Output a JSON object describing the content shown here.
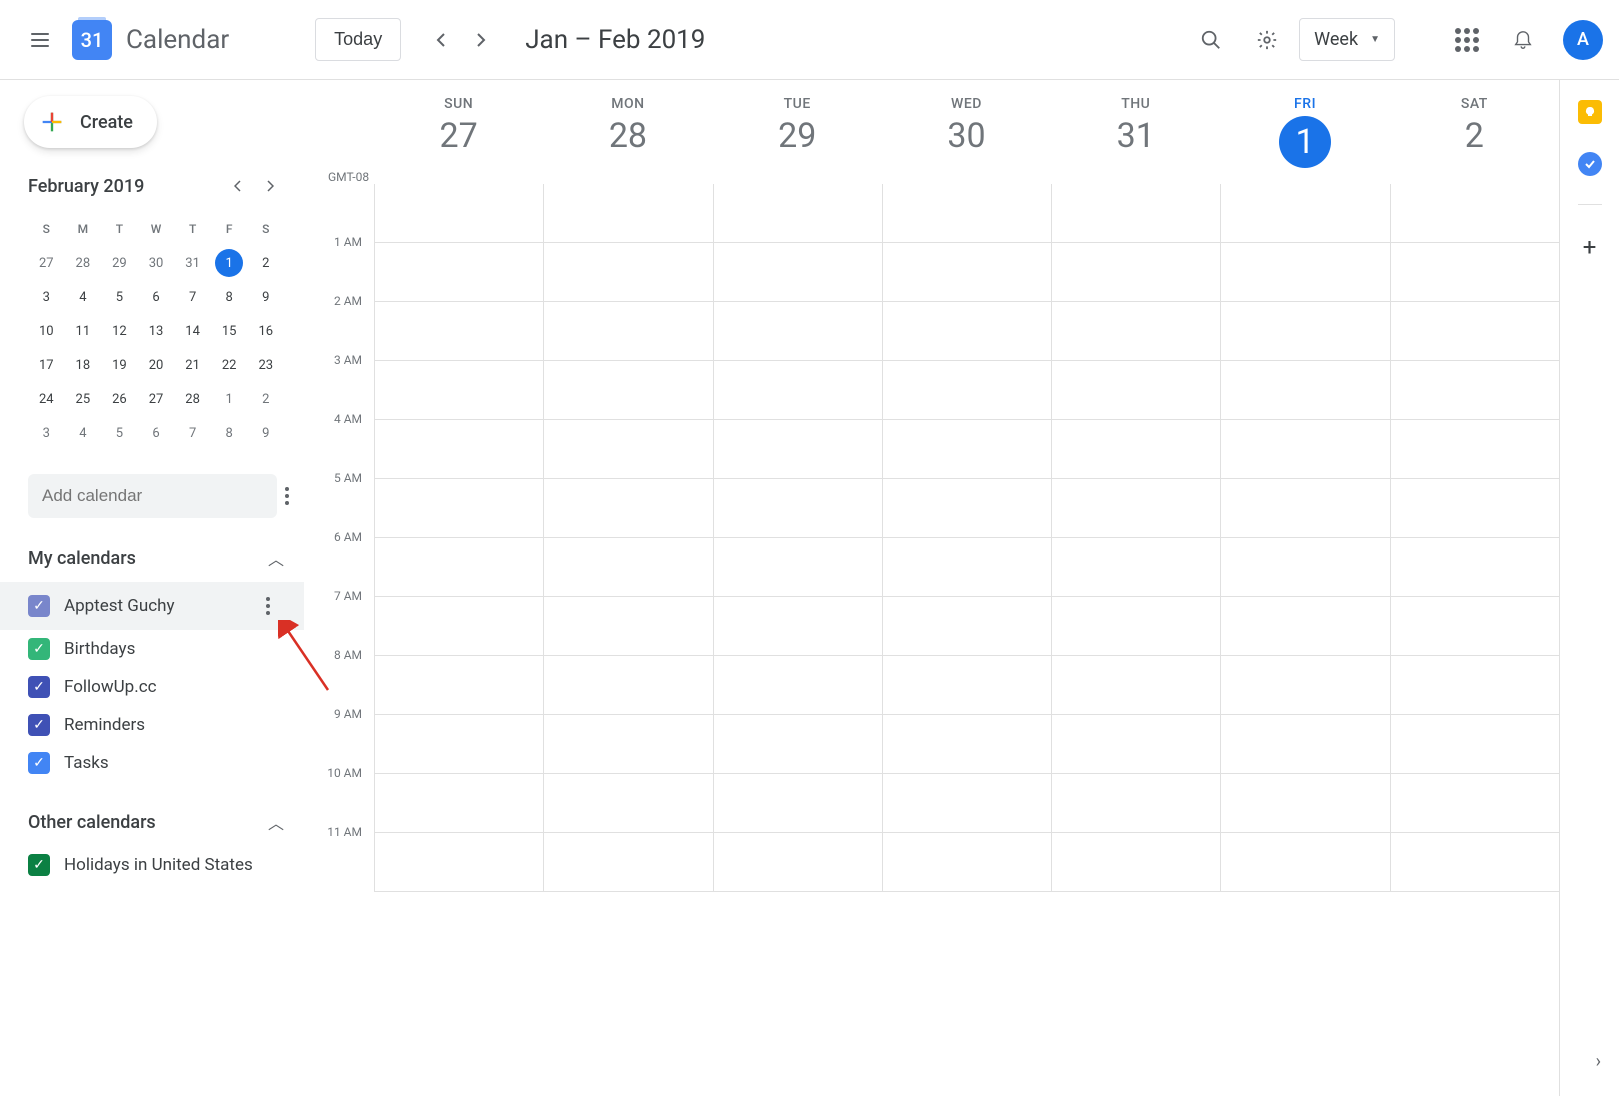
{
  "header": {
    "logo_num": "31",
    "app_title": "Calendar",
    "today_label": "Today",
    "date_range": "Jan – Feb 2019",
    "view_label": "Week",
    "avatar_letter": "A"
  },
  "create_label": "Create",
  "mini_cal": {
    "title": "February 2019",
    "dow": [
      "S",
      "M",
      "T",
      "W",
      "T",
      "F",
      "S"
    ],
    "weeks": [
      [
        {
          "n": "27",
          "o": true
        },
        {
          "n": "28",
          "o": true
        },
        {
          "n": "29",
          "o": true
        },
        {
          "n": "30",
          "o": true
        },
        {
          "n": "31",
          "o": true
        },
        {
          "n": "1",
          "today": true
        },
        {
          "n": "2"
        }
      ],
      [
        {
          "n": "3"
        },
        {
          "n": "4"
        },
        {
          "n": "5"
        },
        {
          "n": "6"
        },
        {
          "n": "7"
        },
        {
          "n": "8"
        },
        {
          "n": "9"
        }
      ],
      [
        {
          "n": "10"
        },
        {
          "n": "11"
        },
        {
          "n": "12"
        },
        {
          "n": "13"
        },
        {
          "n": "14"
        },
        {
          "n": "15"
        },
        {
          "n": "16"
        }
      ],
      [
        {
          "n": "17"
        },
        {
          "n": "18"
        },
        {
          "n": "19"
        },
        {
          "n": "20"
        },
        {
          "n": "21"
        },
        {
          "n": "22"
        },
        {
          "n": "23"
        }
      ],
      [
        {
          "n": "24"
        },
        {
          "n": "25"
        },
        {
          "n": "26"
        },
        {
          "n": "27"
        },
        {
          "n": "28"
        },
        {
          "n": "1",
          "o": true
        },
        {
          "n": "2",
          "o": true
        }
      ],
      [
        {
          "n": "3",
          "o": true
        },
        {
          "n": "4",
          "o": true
        },
        {
          "n": "5",
          "o": true
        },
        {
          "n": "6",
          "o": true
        },
        {
          "n": "7",
          "o": true
        },
        {
          "n": "8",
          "o": true
        },
        {
          "n": "9",
          "o": true
        }
      ]
    ]
  },
  "add_calendar_placeholder": "Add calendar",
  "my_calendars_title": "My calendars",
  "my_calendars": [
    {
      "name": "Apptest Guchy",
      "color": "#7986cb",
      "hovered": true
    },
    {
      "name": "Birthdays",
      "color": "#33b679"
    },
    {
      "name": "FollowUp.cc",
      "color": "#3f51b5"
    },
    {
      "name": "Reminders",
      "color": "#3f51b5"
    },
    {
      "name": "Tasks",
      "color": "#4285f4"
    }
  ],
  "other_calendars_title": "Other calendars",
  "other_calendars": [
    {
      "name": "Holidays in United States",
      "color": "#0b8043"
    }
  ],
  "timezone": "GMT-08",
  "week_days": [
    {
      "dow": "SUN",
      "num": "27"
    },
    {
      "dow": "MON",
      "num": "28"
    },
    {
      "dow": "TUE",
      "num": "29"
    },
    {
      "dow": "WED",
      "num": "30"
    },
    {
      "dow": "THU",
      "num": "31"
    },
    {
      "dow": "FRI",
      "num": "1",
      "today": true
    },
    {
      "dow": "SAT",
      "num": "2"
    }
  ],
  "hours": [
    "1 AM",
    "2 AM",
    "3 AM",
    "4 AM",
    "5 AM",
    "6 AM",
    "7 AM",
    "8 AM",
    "9 AM",
    "10 AM",
    "11 AM"
  ]
}
